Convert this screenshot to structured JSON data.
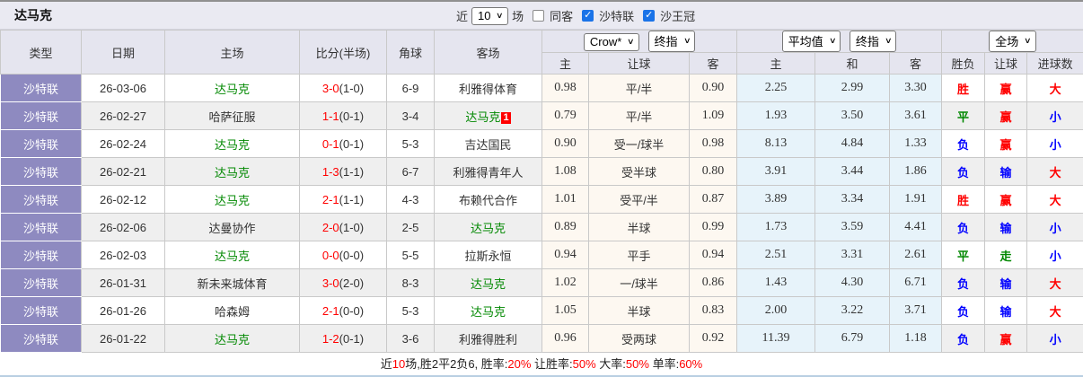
{
  "colors": {
    "red": "#ff0000",
    "green": "#008800",
    "blue": "#0000ff",
    "purple": "#8e8ac0",
    "team_green": "#008800"
  },
  "header": {
    "title": "达马克",
    "near_label": "近",
    "count_select": "10",
    "games_label": "场",
    "filters": [
      {
        "label": "同客",
        "checked": false
      },
      {
        "label": "沙特联",
        "checked": true
      },
      {
        "label": "沙王冠",
        "checked": true
      }
    ]
  },
  "table": {
    "left_headers": [
      "类型",
      "日期",
      "主场",
      "比分(半场)",
      "角球",
      "客场"
    ],
    "selects": {
      "company": "Crow*",
      "company_time": "终指",
      "europe": "平均值",
      "europe_time": "终指",
      "scope": "全场"
    },
    "sub_headers": [
      "主",
      "让球",
      "客",
      "主",
      "和",
      "客",
      "胜负",
      "让球",
      "进球数"
    ],
    "rows": [
      {
        "type": "沙特联",
        "date": "26-03-06",
        "home": "达马克",
        "home_color": "green",
        "score": "3-0",
        "half": "(1-0)",
        "corner": "6-9",
        "away": "利雅得体育",
        "away_color": "",
        "away_badge": "",
        "odds_home": "0.98",
        "handicap": "平/半",
        "odds_away": "0.90",
        "avg_home": "2.25",
        "avg_draw": "2.99",
        "avg_away": "3.30",
        "result": "胜",
        "result_color": "red",
        "cover": "赢",
        "cover_color": "red",
        "goals": "大",
        "goals_color": "red"
      },
      {
        "type": "沙特联",
        "date": "26-02-27",
        "home": "哈萨征服",
        "home_color": "",
        "score": "1-1",
        "half": "(0-1)",
        "corner": "3-4",
        "away": "达马克",
        "away_color": "green",
        "away_badge": "1",
        "odds_home": "0.79",
        "handicap": "平/半",
        "odds_away": "1.09",
        "avg_home": "1.93",
        "avg_draw": "3.50",
        "avg_away": "3.61",
        "result": "平",
        "result_color": "green",
        "cover": "赢",
        "cover_color": "red",
        "goals": "小",
        "goals_color": "blue"
      },
      {
        "type": "沙特联",
        "date": "26-02-24",
        "home": "达马克",
        "home_color": "green",
        "score": "0-1",
        "half": "(0-1)",
        "corner": "5-3",
        "away": "吉达国民",
        "away_color": "",
        "away_badge": "",
        "odds_home": "0.90",
        "handicap": "受一/球半",
        "odds_away": "0.98",
        "avg_home": "8.13",
        "avg_draw": "4.84",
        "avg_away": "1.33",
        "result": "负",
        "result_color": "blue",
        "cover": "赢",
        "cover_color": "red",
        "goals": "小",
        "goals_color": "blue"
      },
      {
        "type": "沙特联",
        "date": "26-02-21",
        "home": "达马克",
        "home_color": "green",
        "score": "1-3",
        "half": "(1-1)",
        "corner": "6-7",
        "away": "利雅得青年人",
        "away_color": "",
        "away_badge": "",
        "odds_home": "1.08",
        "handicap": "受半球",
        "odds_away": "0.80",
        "avg_home": "3.91",
        "avg_draw": "3.44",
        "avg_away": "1.86",
        "result": "负",
        "result_color": "blue",
        "cover": "输",
        "cover_color": "blue",
        "goals": "大",
        "goals_color": "red"
      },
      {
        "type": "沙特联",
        "date": "26-02-12",
        "home": "达马克",
        "home_color": "green",
        "score": "2-1",
        "half": "(1-1)",
        "corner": "4-3",
        "away": "布赖代合作",
        "away_color": "",
        "away_badge": "",
        "odds_home": "1.01",
        "handicap": "受平/半",
        "odds_away": "0.87",
        "avg_home": "3.89",
        "avg_draw": "3.34",
        "avg_away": "1.91",
        "result": "胜",
        "result_color": "red",
        "cover": "赢",
        "cover_color": "red",
        "goals": "大",
        "goals_color": "red"
      },
      {
        "type": "沙特联",
        "date": "26-02-06",
        "home": "达曼协作",
        "home_color": "",
        "score": "2-0",
        "half": "(1-0)",
        "corner": "2-5",
        "away": "达马克",
        "away_color": "green",
        "away_badge": "",
        "odds_home": "0.89",
        "handicap": "半球",
        "odds_away": "0.99",
        "avg_home": "1.73",
        "avg_draw": "3.59",
        "avg_away": "4.41",
        "result": "负",
        "result_color": "blue",
        "cover": "输",
        "cover_color": "blue",
        "goals": "小",
        "goals_color": "blue"
      },
      {
        "type": "沙特联",
        "date": "26-02-03",
        "home": "达马克",
        "home_color": "green",
        "score": "0-0",
        "half": "(0-0)",
        "corner": "5-5",
        "away": "拉斯永恒",
        "away_color": "",
        "away_badge": "",
        "odds_home": "0.94",
        "handicap": "平手",
        "odds_away": "0.94",
        "avg_home": "2.51",
        "avg_draw": "3.31",
        "avg_away": "2.61",
        "result": "平",
        "result_color": "green",
        "cover": "走",
        "cover_color": "green",
        "goals": "小",
        "goals_color": "blue"
      },
      {
        "type": "沙特联",
        "date": "26-01-31",
        "home": "新未来城体育",
        "home_color": "",
        "score": "3-0",
        "half": "(2-0)",
        "corner": "8-3",
        "away": "达马克",
        "away_color": "green",
        "away_badge": "",
        "odds_home": "1.02",
        "handicap": "一/球半",
        "odds_away": "0.86",
        "avg_home": "1.43",
        "avg_draw": "4.30",
        "avg_away": "6.71",
        "result": "负",
        "result_color": "blue",
        "cover": "输",
        "cover_color": "blue",
        "goals": "大",
        "goals_color": "red"
      },
      {
        "type": "沙特联",
        "date": "26-01-26",
        "home": "哈森姆",
        "home_color": "",
        "score": "2-1",
        "half": "(0-0)",
        "corner": "5-3",
        "away": "达马克",
        "away_color": "green",
        "away_badge": "",
        "odds_home": "1.05",
        "handicap": "半球",
        "odds_away": "0.83",
        "avg_home": "2.00",
        "avg_draw": "3.22",
        "avg_away": "3.71",
        "result": "负",
        "result_color": "blue",
        "cover": "输",
        "cover_color": "blue",
        "goals": "大",
        "goals_color": "red"
      },
      {
        "type": "沙特联",
        "date": "26-01-22",
        "home": "达马克",
        "home_color": "green",
        "score": "1-2",
        "half": "(0-1)",
        "corner": "3-6",
        "away": "利雅得胜利",
        "away_color": "",
        "away_badge": "",
        "odds_home": "0.96",
        "handicap": "受两球",
        "odds_away": "0.92",
        "avg_home": "11.39",
        "avg_draw": "6.79",
        "avg_away": "1.18",
        "result": "负",
        "result_color": "blue",
        "cover": "赢",
        "cover_color": "red",
        "goals": "小",
        "goals_color": "blue"
      }
    ]
  },
  "footer": {
    "segments": [
      {
        "text": "近",
        "red": false
      },
      {
        "text": "10",
        "red": true
      },
      {
        "text": "场,胜2平2负6, 胜率:",
        "red": false
      },
      {
        "text": "20%",
        "red": true
      },
      {
        "text": " 让胜率:",
        "red": false
      },
      {
        "text": "50%",
        "red": true
      },
      {
        "text": " 大率:",
        "red": false
      },
      {
        "text": "50%",
        "red": true
      },
      {
        "text": " 单率:",
        "red": false
      },
      {
        "text": "60%",
        "red": true
      }
    ]
  }
}
